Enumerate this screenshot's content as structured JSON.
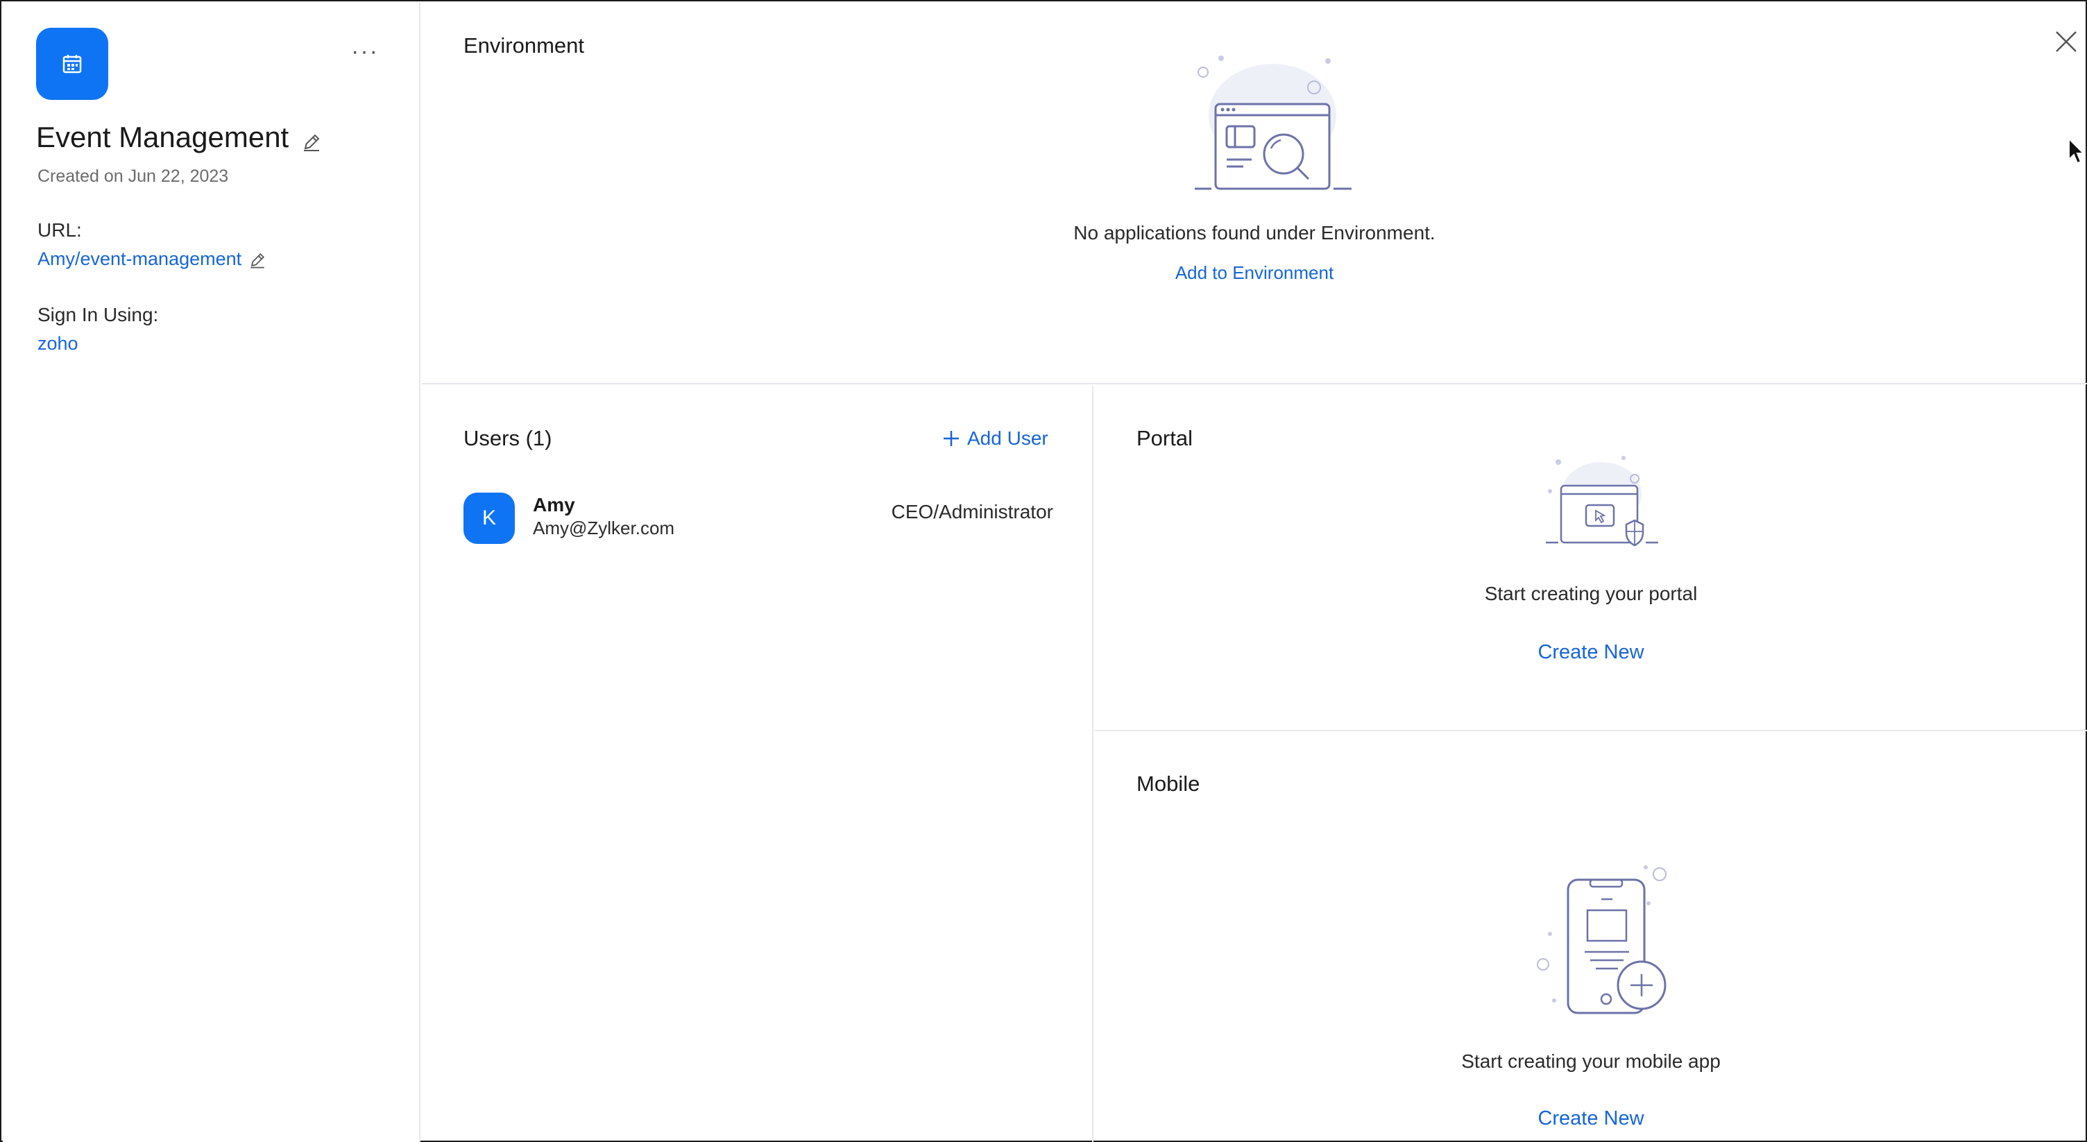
{
  "app": {
    "title": "Event Management",
    "created": "Created on Jun 22, 2023",
    "more_label": "···",
    "url_label": "URL:",
    "url_value": "Amy/event-management",
    "signin_label": "Sign In Using:",
    "signin_value": "zoho"
  },
  "environment": {
    "title": "Environment",
    "empty_message": "No applications found under Environment.",
    "action": "Add to Environment"
  },
  "users": {
    "title": "Users (1)",
    "add_label": "Add User",
    "list": [
      {
        "initial": "K",
        "name": "Amy",
        "email": "Amy@Zylker.com",
        "role": "CEO/Administrator"
      }
    ]
  },
  "portal": {
    "title": "Portal",
    "empty_message": "Start creating your portal",
    "action": "Create New"
  },
  "mobile": {
    "title": "Mobile",
    "empty_message": "Start creating your mobile app",
    "action": "Create New"
  },
  "colors": {
    "accent": "#0f74f3",
    "link": "#1565d8",
    "illustration": "#6d72a8"
  },
  "icons": {
    "app": "calendar-icon",
    "edit": "pencil-icon",
    "close": "close-icon",
    "add": "plus-icon"
  }
}
